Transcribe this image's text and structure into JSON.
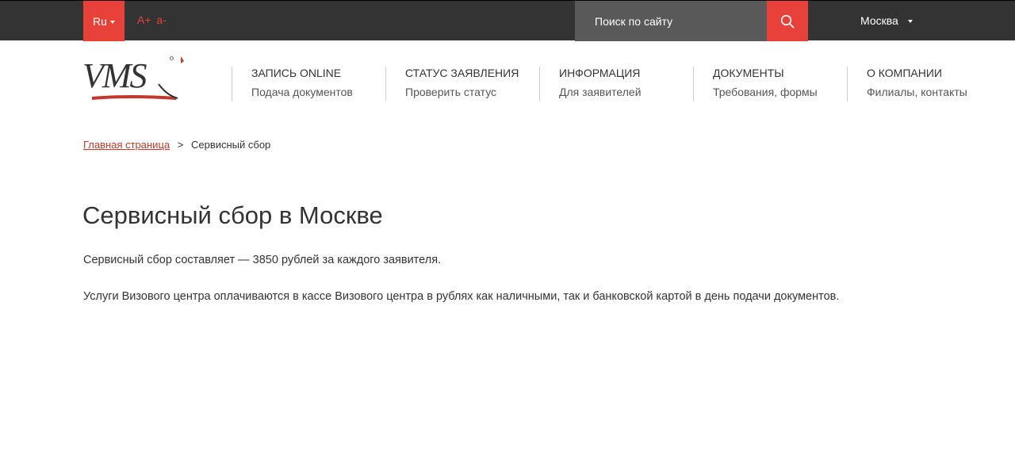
{
  "topbar": {
    "lang_label": "Ru",
    "font_increase": "A+",
    "font_decrease": "a-",
    "search_placeholder": "Поиск по сайту",
    "city": "Москва",
    "colors": {
      "bar": "#333333",
      "accent": "#e8413a",
      "search_bg": "#595959"
    }
  },
  "header": {
    "logo_text": "VMS",
    "nav": [
      {
        "title": "ЗАПИСЬ ONLINE",
        "sub": "Подача документов"
      },
      {
        "title": "СТАТУС ЗАЯВЛЕНИЯ",
        "sub": "Проверить статус"
      },
      {
        "title": "ИНФОРМАЦИЯ",
        "sub": "Для заявителей"
      },
      {
        "title": "ДОКУМЕНТЫ",
        "sub": "Требования, формы"
      },
      {
        "title": "О КОМПАНИИ",
        "sub": "Филиалы, контакты"
      }
    ]
  },
  "breadcrumb": {
    "home": "Главная страница",
    "separator": ">",
    "current": "Сервисный сбор"
  },
  "main": {
    "title": "Сервисный сбор в Москве",
    "paragraphs": [
      "Сервисный сбор составляет — 3850 рублей за каждого заявителя.",
      "Услуги Визового центра оплачиваются в кассе Визового центра в рублях как наличными, так и банковской картой в день подачи документов."
    ]
  }
}
